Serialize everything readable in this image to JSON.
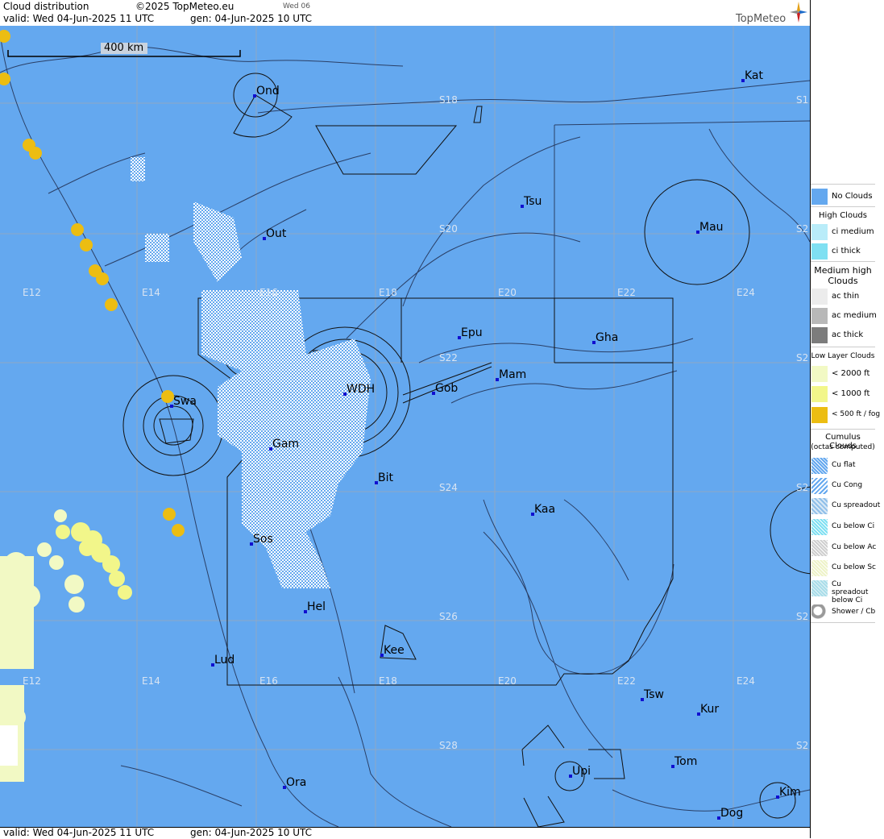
{
  "header": {
    "title": "Cloud distribution",
    "copyright": "©2025 TopMeteo.eu",
    "day_tag": "Wed 06",
    "valid": "valid:  Wed  04-Jun-2025  11 UTC",
    "generated": "gen: 04-Jun-2025 10 UTC",
    "brand": "TopMeteo"
  },
  "footer": {
    "valid": "valid:  Wed  04-Jun-2025  11 UTC",
    "generated": "gen: 04-Jun-2025 10 UTC"
  },
  "scale_bar": {
    "label": "400 km"
  },
  "grid_labels": {
    "lon_top": [
      "E12",
      "E14",
      "E16",
      "E18",
      "E20",
      "E22",
      "E24"
    ],
    "lon_bottom": [
      "E12",
      "E14",
      "E16",
      "E18",
      "E20",
      "E22",
      "E24"
    ],
    "lat_center": [
      "S18",
      "S20",
      "S22",
      "S24",
      "S26",
      "S28"
    ],
    "lat_right": [
      "S1",
      "S2",
      "S2",
      "S2",
      "S2",
      "S2"
    ]
  },
  "places": [
    "Ond",
    "Kat",
    "Tsu",
    "Out",
    "Mau",
    "Epu",
    "Gha",
    "Mam",
    "Gob",
    "WDH",
    "Swa",
    "Gam",
    "Bit",
    "Kaa",
    "Sos",
    "Hel",
    "Lud",
    "Kee",
    "Tsw",
    "Kur",
    "Tom",
    "Upi",
    "Ora",
    "Kim",
    "Dog"
  ],
  "colors": {
    "no_clouds": "#64a8ef",
    "fog": "#ecbd12",
    "low_1000": "#f2f68a",
    "low_2000": "#f2f9c4",
    "cumulus": "#ffffff",
    "place_dot": "#1010d0"
  },
  "legend": {
    "no_clouds": "No Clouds",
    "high_title": "High Clouds",
    "ci_medium": "ci medium",
    "ci_thick": "ci thick",
    "medium_title": "Medium high Clouds",
    "ac_thin": "ac thin",
    "ac_medium": "ac medium",
    "ac_thick": "ac thick",
    "low_title": "Low Layer Clouds",
    "low_2000": "< 2000 ft",
    "low_1000": "< 1000 ft",
    "low_500": "< 500 ft / fog",
    "cu_title": "Cumulus Clouds",
    "cu_subtitle": "(octas computed)",
    "cu_flat": "Cu flat",
    "cu_cong": "Cu Cong",
    "cu_spreadout": "Cu spreadout",
    "cu_below_ci": "Cu below Ci",
    "cu_below_ac": "Cu below Ac",
    "cu_below_sc": "Cu below Sc",
    "cu_spreadout_below_ci": "Cu spreadout below Ci",
    "shower_cb": "Shower / Cb"
  }
}
